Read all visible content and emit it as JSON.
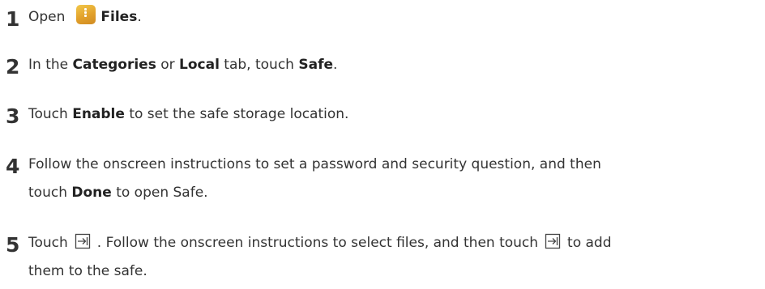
{
  "steps": [
    {
      "num": "1",
      "parts": {
        "a": "Open",
        "b": "Files",
        "c": "."
      },
      "icon": "files-app-icon"
    },
    {
      "num": "2",
      "parts": {
        "a": "In the ",
        "b": "Categories",
        "c": " or ",
        "d": "Local",
        "e": " tab, touch ",
        "f": "Safe",
        "g": "."
      }
    },
    {
      "num": "3",
      "parts": {
        "a": "Touch ",
        "b": "Enable",
        "c": " to set the safe storage location."
      }
    },
    {
      "num": "4",
      "parts": {
        "a": "Follow the onscreen instructions to set a password and security question, and then",
        "b": "touch ",
        "c": "Done",
        "d": " to open Safe."
      }
    },
    {
      "num": "5",
      "parts": {
        "a": "Touch",
        "b": ". Follow the onscreen instructions to select files, and then touch",
        "c": "to add",
        "d": "them to the safe."
      },
      "icon": "move-to-safe-icon"
    }
  ],
  "colors": {
    "text": "#333333",
    "icon_gradient_top": "#f2c84b",
    "icon_gradient_bottom": "#d08b22"
  }
}
